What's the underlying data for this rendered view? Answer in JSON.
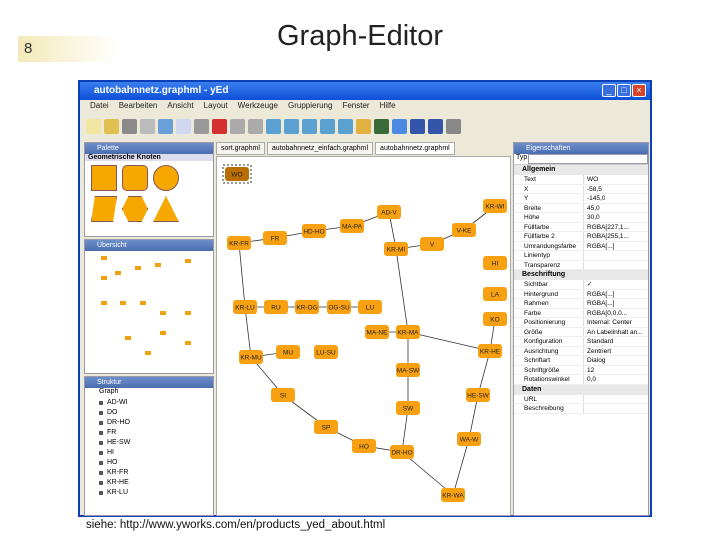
{
  "slide": {
    "number": "8",
    "title": "Graph-Editor",
    "caption": "siehe: http://www.yworks.com/en/products_yed_about.html"
  },
  "window": {
    "title": "autobahnnetz.graphml - yEd",
    "buttons": [
      "_",
      "□",
      "×"
    ]
  },
  "menu": [
    "Datei",
    "Bearbeiten",
    "Ansicht",
    "Layout",
    "Werkzeuge",
    "Gruppierung",
    "Fenster",
    "Hilfe"
  ],
  "palette": {
    "title": "Palette",
    "section": "Geometrische Knoten"
  },
  "overview": {
    "title": "Übersicht"
  },
  "structure": {
    "title": "Struktur",
    "root": "Graph",
    "items": [
      "AD-WI",
      "DO",
      "DR-HO",
      "FR",
      "HE-SW",
      "HI",
      "HO",
      "KR-FR",
      "KR-HE",
      "KR-LU"
    ]
  },
  "tabs": [
    "sort.graphml",
    "autobahnnetz_einfach.graphml",
    "autobahnnetz.graphml"
  ],
  "graph": {
    "nodes": [
      "WO",
      "AD-V",
      "KR-WI",
      "MA-PA",
      "HD-HO",
      "V-KE",
      "FR",
      "KR-FR",
      "V",
      "KR-MI",
      "HI",
      "LA",
      "KR-LU",
      "RU",
      "KR-OG",
      "OG-SU",
      "LU",
      "KO",
      "MA-NE",
      "KR-MA",
      "KR-HE",
      "KR-MU",
      "MU",
      "LU-SU",
      "MA-SW",
      "SI",
      "HE-SW",
      "SW",
      "SP",
      "WA-W",
      "HO",
      "DR-HO",
      "KR-WA"
    ],
    "edges": [
      [
        "KR-FR",
        "FR"
      ],
      [
        "FR",
        "HD-HO"
      ],
      [
        "HD-HO",
        "MA-PA"
      ],
      [
        "MA-PA",
        "AD-V"
      ],
      [
        "AD-V",
        "KR-MI"
      ],
      [
        "KR-MI",
        "V"
      ],
      [
        "V",
        "V-KE"
      ],
      [
        "V-KE",
        "KR-WI"
      ],
      [
        "KR-FR",
        "KR-LU"
      ],
      [
        "KR-LU",
        "RU"
      ],
      [
        "RU",
        "KR-OG"
      ],
      [
        "KR-OG",
        "OG-SU"
      ],
      [
        "OG-SU",
        "LU"
      ],
      [
        "KR-MI",
        "KR-MA"
      ],
      [
        "MA-NE",
        "KR-MA"
      ],
      [
        "KR-MA",
        "KR-HE"
      ],
      [
        "KO",
        "KR-HE"
      ],
      [
        "KR-LU",
        "KR-MU"
      ],
      [
        "KR-MU",
        "MU"
      ],
      [
        "KR-MU",
        "SI"
      ],
      [
        "KR-MA",
        "MA-SW"
      ],
      [
        "MA-SW",
        "SW"
      ],
      [
        "SW",
        "DR-HO"
      ],
      [
        "SI",
        "SP"
      ],
      [
        "SP",
        "HO"
      ],
      [
        "HO",
        "DR-HO"
      ],
      [
        "DR-HO",
        "KR-WA"
      ],
      [
        "KR-HE",
        "HE-SW"
      ],
      [
        "HE-SW",
        "WA-W"
      ],
      [
        "WA-W",
        "KR-WA"
      ]
    ],
    "selected": "WO",
    "node_color": "#f7a011",
    "selected_color": "#b86e00"
  },
  "properties": {
    "title": "Eigenschaften",
    "type_label": "Typ",
    "sections": [
      {
        "name": "Allgemein",
        "rows": [
          [
            "Text",
            "WO"
          ],
          [
            "X",
            "-58,5"
          ],
          [
            "Y",
            "-145,0"
          ],
          [
            "Breite",
            "45,0"
          ],
          [
            "Höhe",
            "30,0"
          ],
          [
            "Füllfarbe",
            "RGBA[227,1..."
          ],
          [
            "Füllfarbe 2",
            "RGBA[255,1..."
          ],
          [
            "Umrandungsfarbe",
            "RGBA[...]"
          ],
          [
            "Linientyp",
            ""
          ],
          [
            "Transparenz",
            ""
          ]
        ]
      },
      {
        "name": "Beschriftung",
        "rows": [
          [
            "Sichtbar",
            "✓"
          ],
          [
            "Hintergrund",
            "RGBA[...]"
          ],
          [
            "Rahmen",
            "RGBA[...]"
          ],
          [
            "Farbe",
            "RGBA[0,0,0..."
          ],
          [
            "Positionierung",
            "Internal: Center"
          ],
          [
            "Größe",
            "An Labelinhalt an..."
          ],
          [
            "Konfiguration",
            "Standard"
          ],
          [
            "Ausrichtung",
            "Zentriert"
          ],
          [
            "Schriftart",
            "Dialog"
          ],
          [
            "Schriftgröße",
            "12"
          ],
          [
            "Rotationswinkel",
            "0,0"
          ]
        ]
      },
      {
        "name": "Daten",
        "rows": [
          [
            "URL",
            ""
          ],
          [
            "Beschreibung",
            ""
          ]
        ]
      }
    ]
  }
}
